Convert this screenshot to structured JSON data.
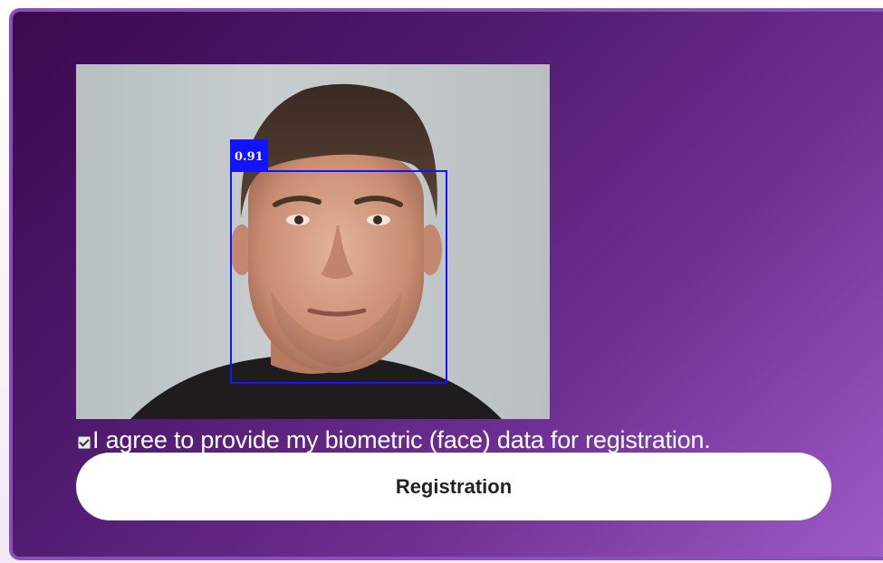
{
  "camera": {
    "detection_score": "0.91"
  },
  "consent": {
    "checked": true,
    "label": "I agree to provide my biometric (face) data for registration."
  },
  "actions": {
    "register_label": "Registration"
  },
  "colors": {
    "card_gradient_start": "#3a0a4f",
    "card_gradient_end": "#9f5cc8",
    "detection_box": "#1313ff",
    "button_bg": "#ffffff"
  }
}
